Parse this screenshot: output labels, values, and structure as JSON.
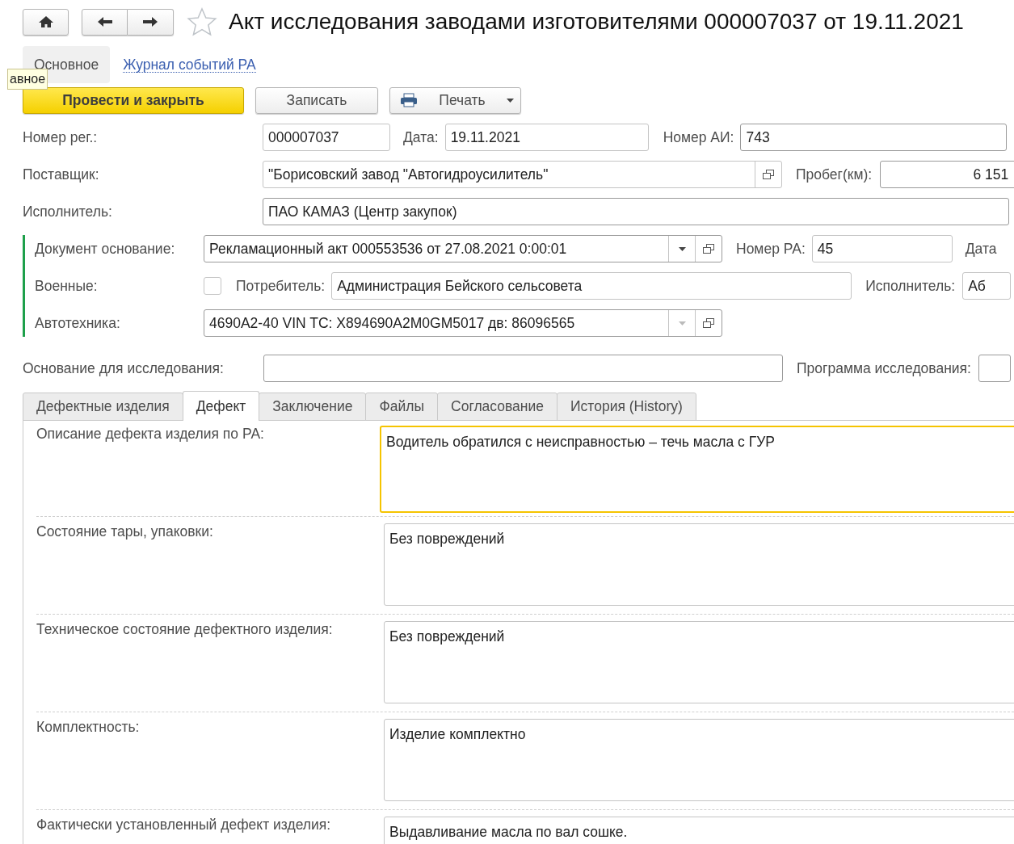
{
  "header": {
    "title": "Акт исследования заводами изготовителями 000007037 от 19.11.2021"
  },
  "nav_items": [
    {
      "kind": "tab",
      "label": "Основное",
      "selected": true
    },
    {
      "kind": "link",
      "label": "Журнал событий РА",
      "selected": false
    }
  ],
  "tooltip": "авное",
  "toolbar": [
    {
      "kind": "primary",
      "label": "Провести и закрыть"
    },
    {
      "kind": "plain",
      "label": "Записать"
    },
    {
      "kind": "print",
      "label": "Печать"
    }
  ],
  "reg_number": {
    "label": "Номер рег.:",
    "value": "000007037"
  },
  "date": {
    "label": "Дата:",
    "value": "19.11.2021"
  },
  "ai_number": {
    "label": "Номер АИ:",
    "value": "743"
  },
  "supplier": {
    "label": "Поставщик:",
    "value": "\"Борисовский завод \"Автогидроусилитель\""
  },
  "mileage": {
    "label": "Пробег(км):",
    "value": "6 151"
  },
  "executor": {
    "label": "Исполнитель:",
    "value": "ПАО КАМАЗ (Центр закупок)"
  },
  "basis_document": {
    "label": "Документ основание:",
    "value": "Рекламационный акт 000553536 от 27.08.2021 0:00:01",
    "dropdown_disabled": false
  },
  "ra_number": {
    "label": "Номер РА:",
    "value": "45"
  },
  "ra_date": {
    "label": "Дата"
  },
  "military": {
    "label": "Военные:",
    "checked": false
  },
  "consumer": {
    "label": "Потребитель:",
    "value": "Администрация Бейского сельсовета"
  },
  "consumer_executor": {
    "label": "Исполнитель:",
    "value": "Аб"
  },
  "vehicle": {
    "label": "Автотехника:",
    "value": "4690A2-40 VIN TC: X894690A2M0GM5017 дв: 86096565",
    "dropdown_disabled": true
  },
  "research_basis": {
    "label": "Основание для исследования:"
  },
  "research_program": {
    "label": "Программа исследования:"
  },
  "tabs": [
    {
      "label": "Дефектные изделия",
      "selected": false
    },
    {
      "label": "Дефект",
      "selected": true
    },
    {
      "label": "Заключение",
      "selected": false
    },
    {
      "label": "Файлы",
      "selected": false
    },
    {
      "label": "Согласование",
      "selected": false
    },
    {
      "label": "История (History)",
      "selected": false
    }
  ],
  "defect_fields": [
    {
      "label": "Описание дефекта изделия по РА:",
      "value": "Водитель обратился с неисправностью – течь масла с ГУР",
      "focused": true
    },
    {
      "label": "Состояние тары, упаковки:",
      "value": "Без повреждений",
      "focused": false
    },
    {
      "label": "Техническое состояние дефектного изделия:",
      "value": "Без повреждений",
      "focused": false
    },
    {
      "label": "Комплектность:",
      "value": "Изделие комплектно",
      "focused": false
    },
    {
      "label": "Фактически установленный дефект изделия:",
      "value": "Выдавливание масла по вал сошке.",
      "focused": false
    }
  ]
}
